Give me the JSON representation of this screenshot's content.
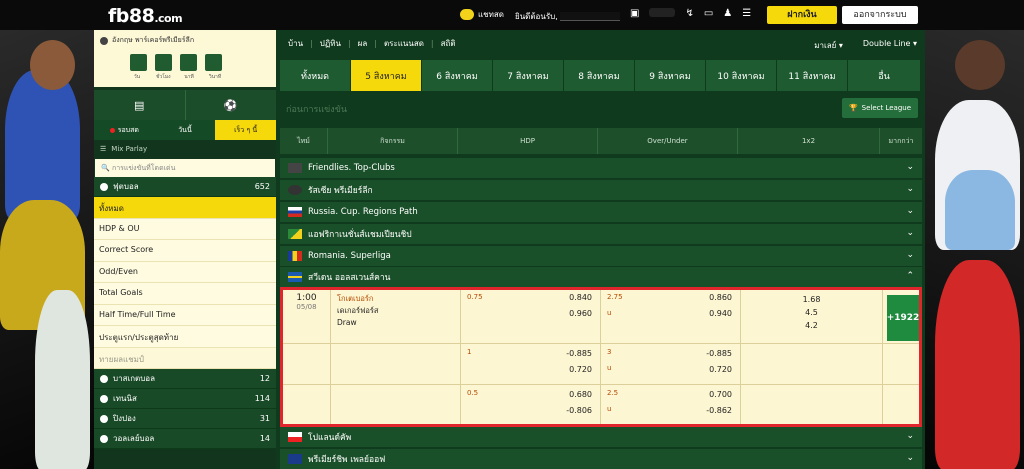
{
  "topbar": {
    "logo": "fb88",
    "logo_suffix": ".com",
    "chat_label": "แชทสด",
    "welcome": "ยินดีต้อนรับ,",
    "deposit": "ฝากเงิน",
    "logout": "ออกจากระบบ"
  },
  "sidebar": {
    "league": "อังกฤษ พาร์เคอร์พรีเมียร์ลีก",
    "clock_labels": [
      "วัน",
      "ชั่วโมง",
      "นาที",
      "วินาที"
    ],
    "tabs": [
      "รอบสด",
      "วันนี้",
      "เร็ว ๆ นี้"
    ],
    "mix_parlay": "Mix Parlay",
    "search_placeholder": "การแข่งขันที่โดดเด่น",
    "football": {
      "label": "ฟุตบอล",
      "count": "652"
    },
    "menu": [
      "ทั้งหมด",
      "HDP & OU",
      "Correct Score",
      "Odd/Even",
      "Total Goals",
      "Half Time/Full Time",
      "ประตูแรก/ประตูสุดท้าย",
      "ทายผลแชมป์"
    ],
    "sports": [
      {
        "label": "บาสเกตบอล",
        "count": "12"
      },
      {
        "label": "เทนนิส",
        "count": "114"
      },
      {
        "label": "ปิงปอง",
        "count": "31"
      },
      {
        "label": "วอลเลย์บอล",
        "count": "14"
      }
    ]
  },
  "main": {
    "nav": [
      "บ้าน",
      "ปฏิทิน",
      "ผล",
      "ตระแนนสด",
      "สถิติ"
    ],
    "lang": "มาเลย์",
    "odds_view": "Double Line",
    "date_tabs": [
      "ทั้งหมด",
      "5 สิงหาคม",
      "6 สิงหาคม",
      "7 สิงหาคม",
      "8 สิงหาคม",
      "9 สิงหาคม",
      "10 สิงหาคม",
      "11 สิงหาคม",
      "อื่น"
    ],
    "sub_title": "ก่อนการแข่งขัน",
    "select_league": "Select League",
    "columns": [
      "ไทม์",
      "กิจกรรม",
      "HDP",
      "Over/Under",
      "1x2",
      "มากกว่า"
    ]
  },
  "leagues_top": [
    {
      "name": "Friendlies. Top-Clubs",
      "color": "#444"
    },
    {
      "name": "รัสเซีย พรีเมียร์ลีก",
      "color": "#333"
    },
    {
      "name": "Russia. Cup. Regions Path",
      "color": "#fff"
    },
    {
      "name": "แอฟริกาเนชั่นส์แชมเปียนชิป",
      "color": "#2a8a3a"
    },
    {
      "name": "Romania. Superliga",
      "color": "#1a3a9a"
    },
    {
      "name": "สวีเดน ออลสเวนส์คาน",
      "color": "#1a5ab0"
    }
  ],
  "leagues_bottom": [
    {
      "name": "โปแลนด์คัพ",
      "color": "#e22"
    },
    {
      "name": "พรีเมียร์ชิพ เพลย์ออฟ",
      "color": "#1a3a8a"
    }
  ],
  "match": {
    "time": "1:00",
    "date": "05/08",
    "home": "โกเตเบอร์ก",
    "away": "เดเกอร์ฟอร์ส",
    "draw": "Draw",
    "more": "+1922",
    "rows": [
      {
        "hdp_line": "0.75",
        "hdp1": "0.840",
        "hdp2": "0.960",
        "ou_line": "2.75",
        "ou_u": "u",
        "ou1": "0.860",
        "ou2": "0.940",
        "x1": "1.68",
        "x2": "4.5",
        "x3": "4.2"
      },
      {
        "hdp_line": "1",
        "hdp1": "-0.885",
        "hdp2": "0.720",
        "ou_line": "3",
        "ou_u": "u",
        "ou1": "-0.885",
        "ou2": "0.720"
      },
      {
        "hdp_line": "0.5",
        "hdp1": "0.680",
        "hdp2": "-0.806",
        "ou_line": "2.5",
        "ou_u": "u",
        "ou1": "0.700",
        "ou2": "-0.862"
      }
    ]
  }
}
